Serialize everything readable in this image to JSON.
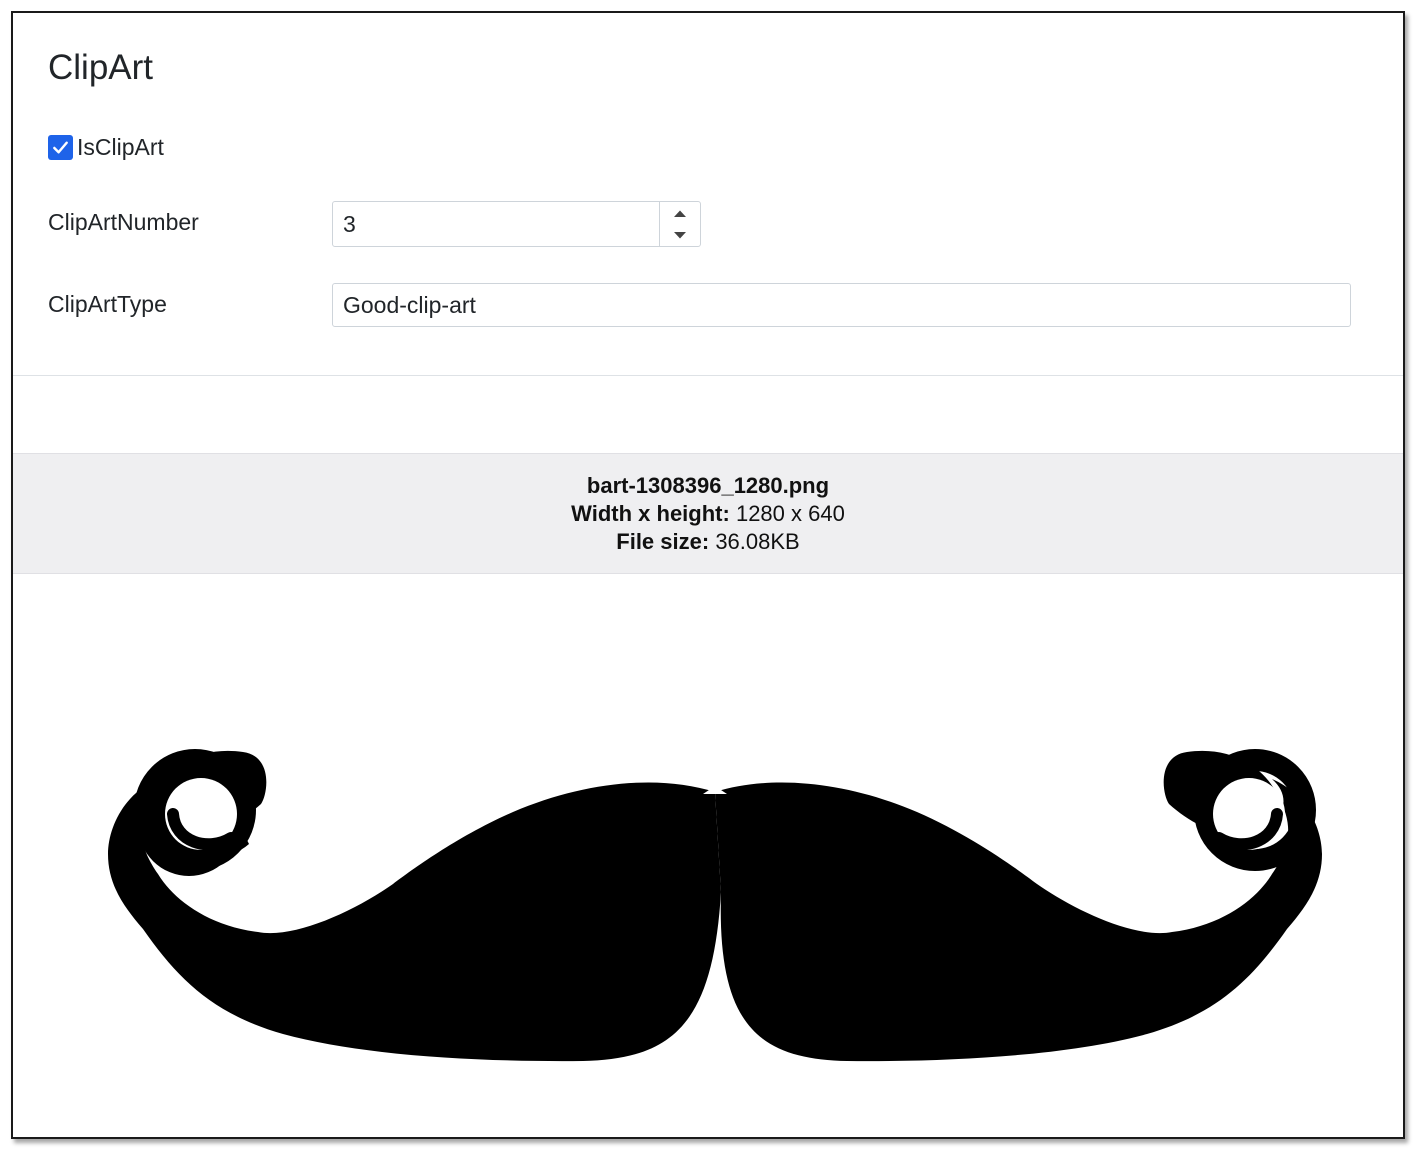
{
  "panel": {
    "title": "ClipArt"
  },
  "is_clip_art": {
    "label": "IsClipArt",
    "checked": true
  },
  "clip_art_number": {
    "label": "ClipArtNumber",
    "value": "3"
  },
  "clip_art_type": {
    "label": "ClipArtType",
    "value": "Good-clip-art"
  },
  "file_info": {
    "file_name": "bart-1308396_1280.png",
    "dimensions_label": "Width x height:",
    "dimensions_value": "1280 x 640",
    "size_label": "File size:",
    "size_value": "36.08KB"
  },
  "preview": {
    "icon": "mustache-image"
  },
  "colors": {
    "accent": "#1e63e9",
    "info_bar_bg": "#efeff1"
  }
}
